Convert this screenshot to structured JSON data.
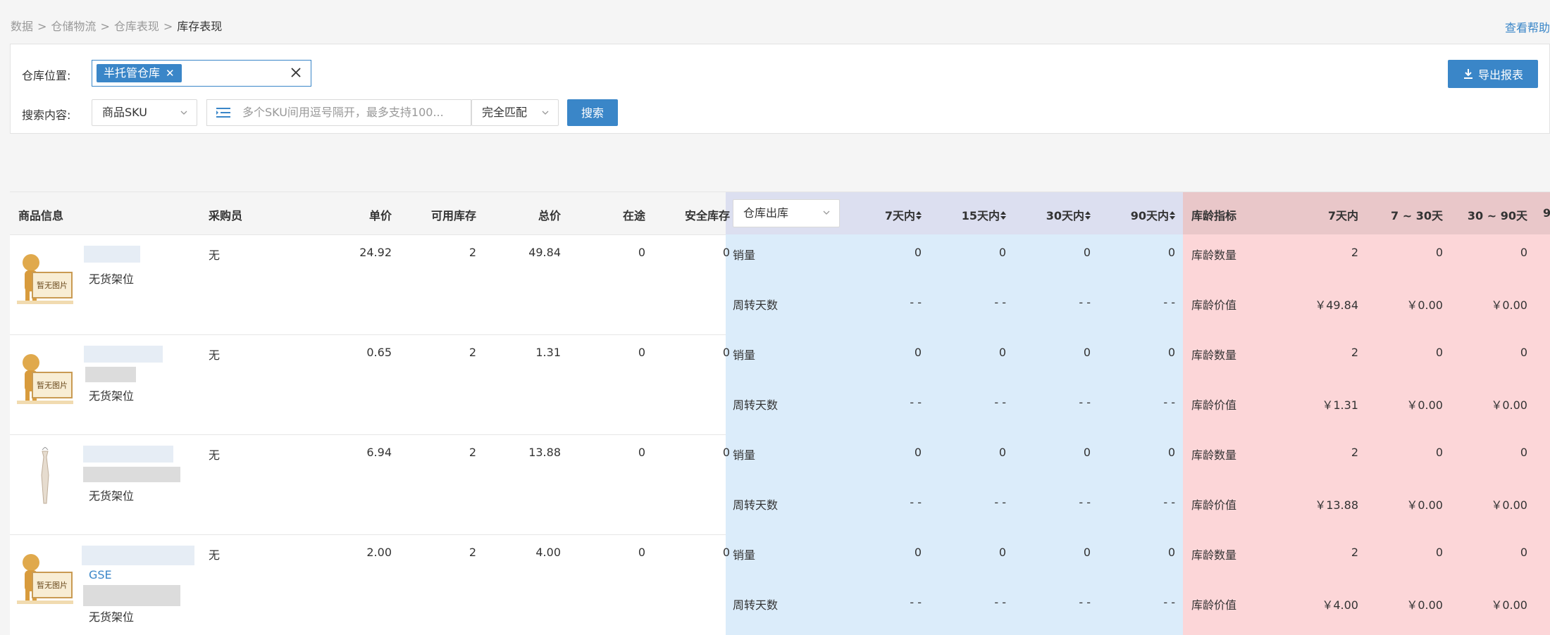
{
  "breadcrumb": [
    "数据",
    "仓储物流",
    "仓库表现",
    "库存表现"
  ],
  "help_link": "查看帮助",
  "filters": {
    "location_label": "仓库位置:",
    "location_tag": "半托管仓库",
    "search_label": "搜索内容:",
    "search_field": "商品SKU",
    "search_placeholder": "多个SKU间用逗号隔开，最多支持100...",
    "match_mode": "完全匹配",
    "search_button": "搜索",
    "export_button": "导出报表"
  },
  "table": {
    "headers": {
      "product": "商品信息",
      "buyer": "采购员",
      "unit_price": "单价",
      "available": "可用库存",
      "total": "总价",
      "in_transit": "在途",
      "safety": "安全库存",
      "outbound_select": "仓库出库",
      "d7": "7天内",
      "d15": "15天内",
      "d30": "30天内",
      "d90": "90天内",
      "age_metric": "库龄指标",
      "age_7": "7天内",
      "age_7_30": "7 ~ 30天",
      "age_30_90": "30 ~ 90天",
      "age_90_cut": "9"
    },
    "labels": {
      "sales": "销量",
      "turnover": "周转天数",
      "age_qty": "库龄数量",
      "age_value": "库龄价值",
      "no_image": "暂无图片",
      "no_shelf": "无货架位"
    },
    "rows": [
      {
        "buyer": "无",
        "unit_price": "24.92",
        "available": "2",
        "total": "49.84",
        "in_transit": "0",
        "safety": "0",
        "sales": [
          "0",
          "0",
          "0",
          "0"
        ],
        "turnover": [
          "- -",
          "- -",
          "- -",
          "- -"
        ],
        "age_qty": [
          "2",
          "0",
          "0"
        ],
        "age_value": [
          "￥49.84",
          "￥0.00",
          "￥0.00"
        ],
        "extra_text": ""
      },
      {
        "buyer": "无",
        "unit_price": "0.65",
        "available": "2",
        "total": "1.31",
        "in_transit": "0",
        "safety": "0",
        "sales": [
          "0",
          "0",
          "0",
          "0"
        ],
        "turnover": [
          "- -",
          "- -",
          "- -",
          "- -"
        ],
        "age_qty": [
          "2",
          "0",
          "0"
        ],
        "age_value": [
          "￥1.31",
          "￥0.00",
          "￥0.00"
        ],
        "extra_text": ""
      },
      {
        "buyer": "无",
        "unit_price": "6.94",
        "available": "2",
        "total": "13.88",
        "in_transit": "0",
        "safety": "0",
        "sales": [
          "0",
          "0",
          "0",
          "0"
        ],
        "turnover": [
          "- -",
          "- -",
          "- -",
          "- -"
        ],
        "age_qty": [
          "2",
          "0",
          "0"
        ],
        "age_value": [
          "￥13.88",
          "￥0.00",
          "￥0.00"
        ],
        "extra_text": ""
      },
      {
        "buyer": "无",
        "unit_price": "2.00",
        "available": "2",
        "total": "4.00",
        "in_transit": "0",
        "safety": "0",
        "sales": [
          "0",
          "0",
          "0",
          "0"
        ],
        "turnover": [
          "- -",
          "- -",
          "- -",
          "- -"
        ],
        "age_qty": [
          "2",
          "0",
          "0"
        ],
        "age_value": [
          "￥4.00",
          "￥0.00",
          "￥0.00"
        ],
        "extra_text": "GSE"
      }
    ]
  },
  "colors": {
    "accent": "#3a86c8",
    "blue_section": "#dbecfa",
    "pink_section": "#fcd6d8"
  }
}
